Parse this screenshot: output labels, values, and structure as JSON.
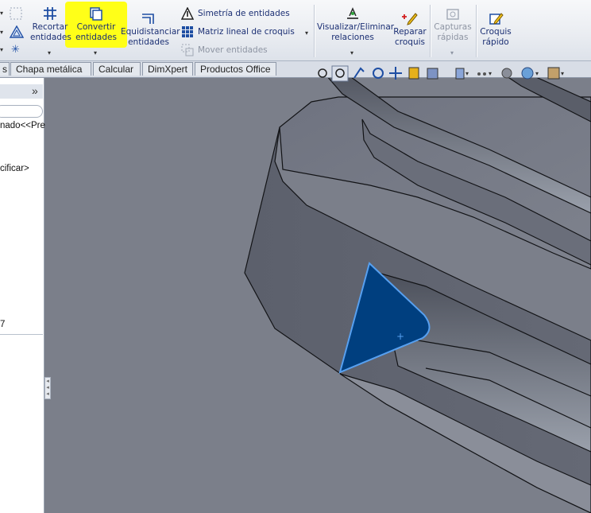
{
  "ribbon": {
    "recortar": "Recortar\nentidades",
    "recortar_l1": "Recortar",
    "recortar_l2": "entidades",
    "convertir_l1": "Convertir",
    "convertir_l2": "entidades",
    "equid_l1": "Equidistanciar",
    "equid_l2": "entidades",
    "simetria": "Simetría de entidades",
    "matriz": "Matriz lineal de croquis",
    "mover": "Mover entidades",
    "visualizar_l1": "Visualizar/Eliminar",
    "visualizar_l2": "relaciones",
    "reparar_l1": "Reparar",
    "reparar_l2": "croquis",
    "capturas_l1": "Capturas",
    "capturas_l2": "rápidas",
    "croquis_l1": "Croquis",
    "croquis_l2": "rápido",
    "highlight_color": "#ffff18"
  },
  "tabs": [
    "s",
    "Chapa metálica",
    "Calcular",
    "DimXpert",
    "Productos Office"
  ],
  "left_panel": {
    "expand_glyph": "»",
    "line1": "nado<<Pre",
    "line2": "cificar>",
    "line3": "7"
  },
  "viewport": {
    "background": "#7b7f8a",
    "sketch_fill": "#003f7f",
    "sketch_edge": "#57a0f0",
    "origin_marker": "+"
  },
  "hud_icons": [
    "zoom-to-fit-icon",
    "zoom-area-icon",
    "previous-view-icon",
    "rotate-icon",
    "pan-icon",
    "section-view-icon",
    "view-orientation-icon",
    "display-style-icon",
    "hide-show-icon",
    "edit-appearance-icon",
    "scene-icon",
    "view-settings-icon"
  ]
}
